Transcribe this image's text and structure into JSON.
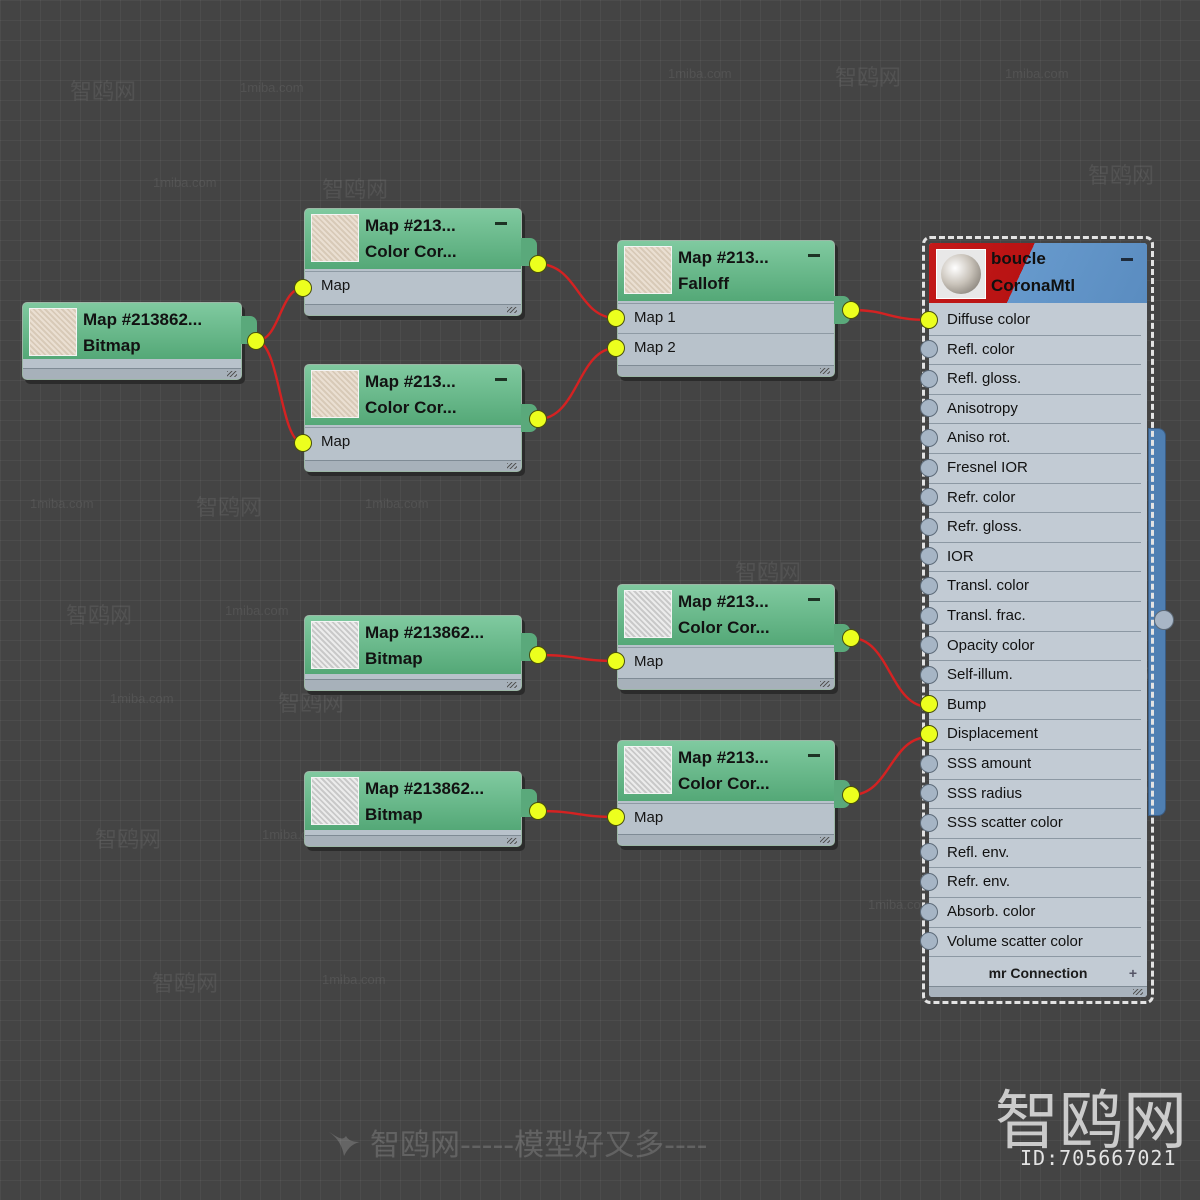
{
  "nodes": {
    "bitmap_1": {
      "title1": "Map  #213862...",
      "title2": "Bitmap"
    },
    "cc_1": {
      "title1": "Map  #213...",
      "title2": "Color Cor...",
      "slot": "Map"
    },
    "cc_2": {
      "title1": "Map  #213...",
      "title2": "Color Cor...",
      "slot": "Map"
    },
    "falloff": {
      "title1": "Map  #213...",
      "title2": "Falloff",
      "slot1": "Map 1",
      "slot2": "Map 2"
    },
    "bitmap_2": {
      "title1": "Map  #213862...",
      "title2": "Bitmap"
    },
    "cc_3": {
      "title1": "Map  #213...",
      "title2": "Color Cor...",
      "slot": "Map"
    },
    "bitmap_3": {
      "title1": "Map  #213862...",
      "title2": "Bitmap"
    },
    "cc_4": {
      "title1": "Map  #213...",
      "title2": "Color Cor...",
      "slot": "Map"
    }
  },
  "material": {
    "name": "boucle",
    "type": "CoronaMtl",
    "slots": [
      "Diffuse color",
      "Refl. color",
      "Refl. gloss.",
      "Anisotropy",
      "Aniso rot.",
      "Fresnel IOR",
      "Refr. color",
      "Refr. gloss.",
      "IOR",
      "Transl. color",
      "Transl. frac.",
      "Opacity color",
      "Self-illum.",
      "Bump",
      "Displacement",
      "SSS amount",
      "SSS radius",
      "SSS scatter color",
      "Refl. env.",
      "Refr. env.",
      "Absorb. color",
      "Volume scatter color"
    ],
    "connected_slots": [
      "Diffuse color",
      "Bump",
      "Displacement"
    ],
    "mr_connection": "mr Connection"
  },
  "watermarks": {
    "brand": "智鸥网",
    "id": "ID:705667021",
    "bottom": "智鸥网-----模型好又多----",
    "site": "1miba.com",
    "tiled": "智鸥网"
  },
  "colors": {
    "wire": "#d42222",
    "port_connected": "#ecff1e",
    "node_header": "#54a877",
    "material_header_red": "#c41919",
    "material_header_blue": "#5a8cc0"
  }
}
